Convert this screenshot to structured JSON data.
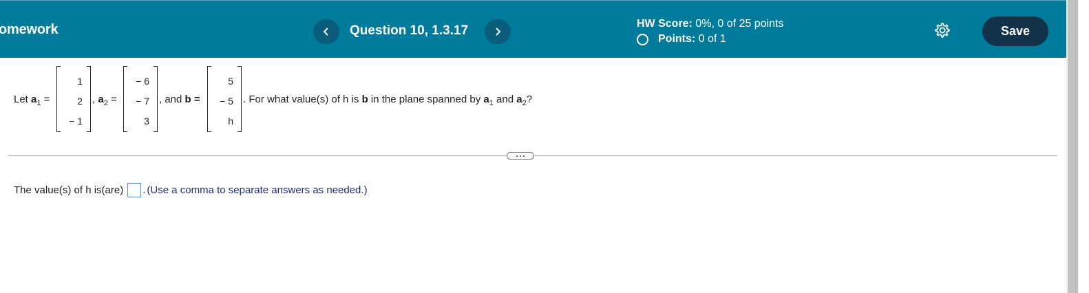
{
  "header": {
    "app_title": "omework",
    "question_title": "Question 10, 1.3.17",
    "hw_score_label": "HW Score:",
    "hw_score_value": "0%, 0 of 25 points",
    "points_label": "Points:",
    "points_value": "0 of 1",
    "save_label": "Save",
    "icons": {
      "prev": "chevron-left-icon",
      "next": "chevron-right-icon",
      "settings": "gear-icon",
      "points_status": "radio-empty-icon"
    },
    "colors": {
      "header_bg": "#007b9c",
      "nav_btn": "#0a5d7a",
      "save_btn": "#12324a"
    }
  },
  "question": {
    "let": "Let",
    "a1_label": "a",
    "a1_sub": "1",
    "eq": "=",
    "a1": [
      "1",
      "2",
      "− 1"
    ],
    "comma": ",",
    "a2_label": "a",
    "a2_sub": "2",
    "a2": [
      "− 6",
      "− 7",
      "3"
    ],
    "and_b": ", and",
    "b_label": "b",
    "b": [
      "5",
      "− 5",
      "h"
    ],
    "prompt_start": ". For what value(s) of h is",
    "prompt_b": "b",
    "prompt_mid": "in the plane spanned by",
    "prompt_a1": "a",
    "prompt_a1_sub": "1",
    "prompt_and": "and",
    "prompt_a2": "a",
    "prompt_a2_sub": "2",
    "prompt_end": "?"
  },
  "answer": {
    "lead": "The value(s) of h is(are)",
    "after_box": ".",
    "hint": "(Use a comma to separate answers as needed.)",
    "value": ""
  }
}
